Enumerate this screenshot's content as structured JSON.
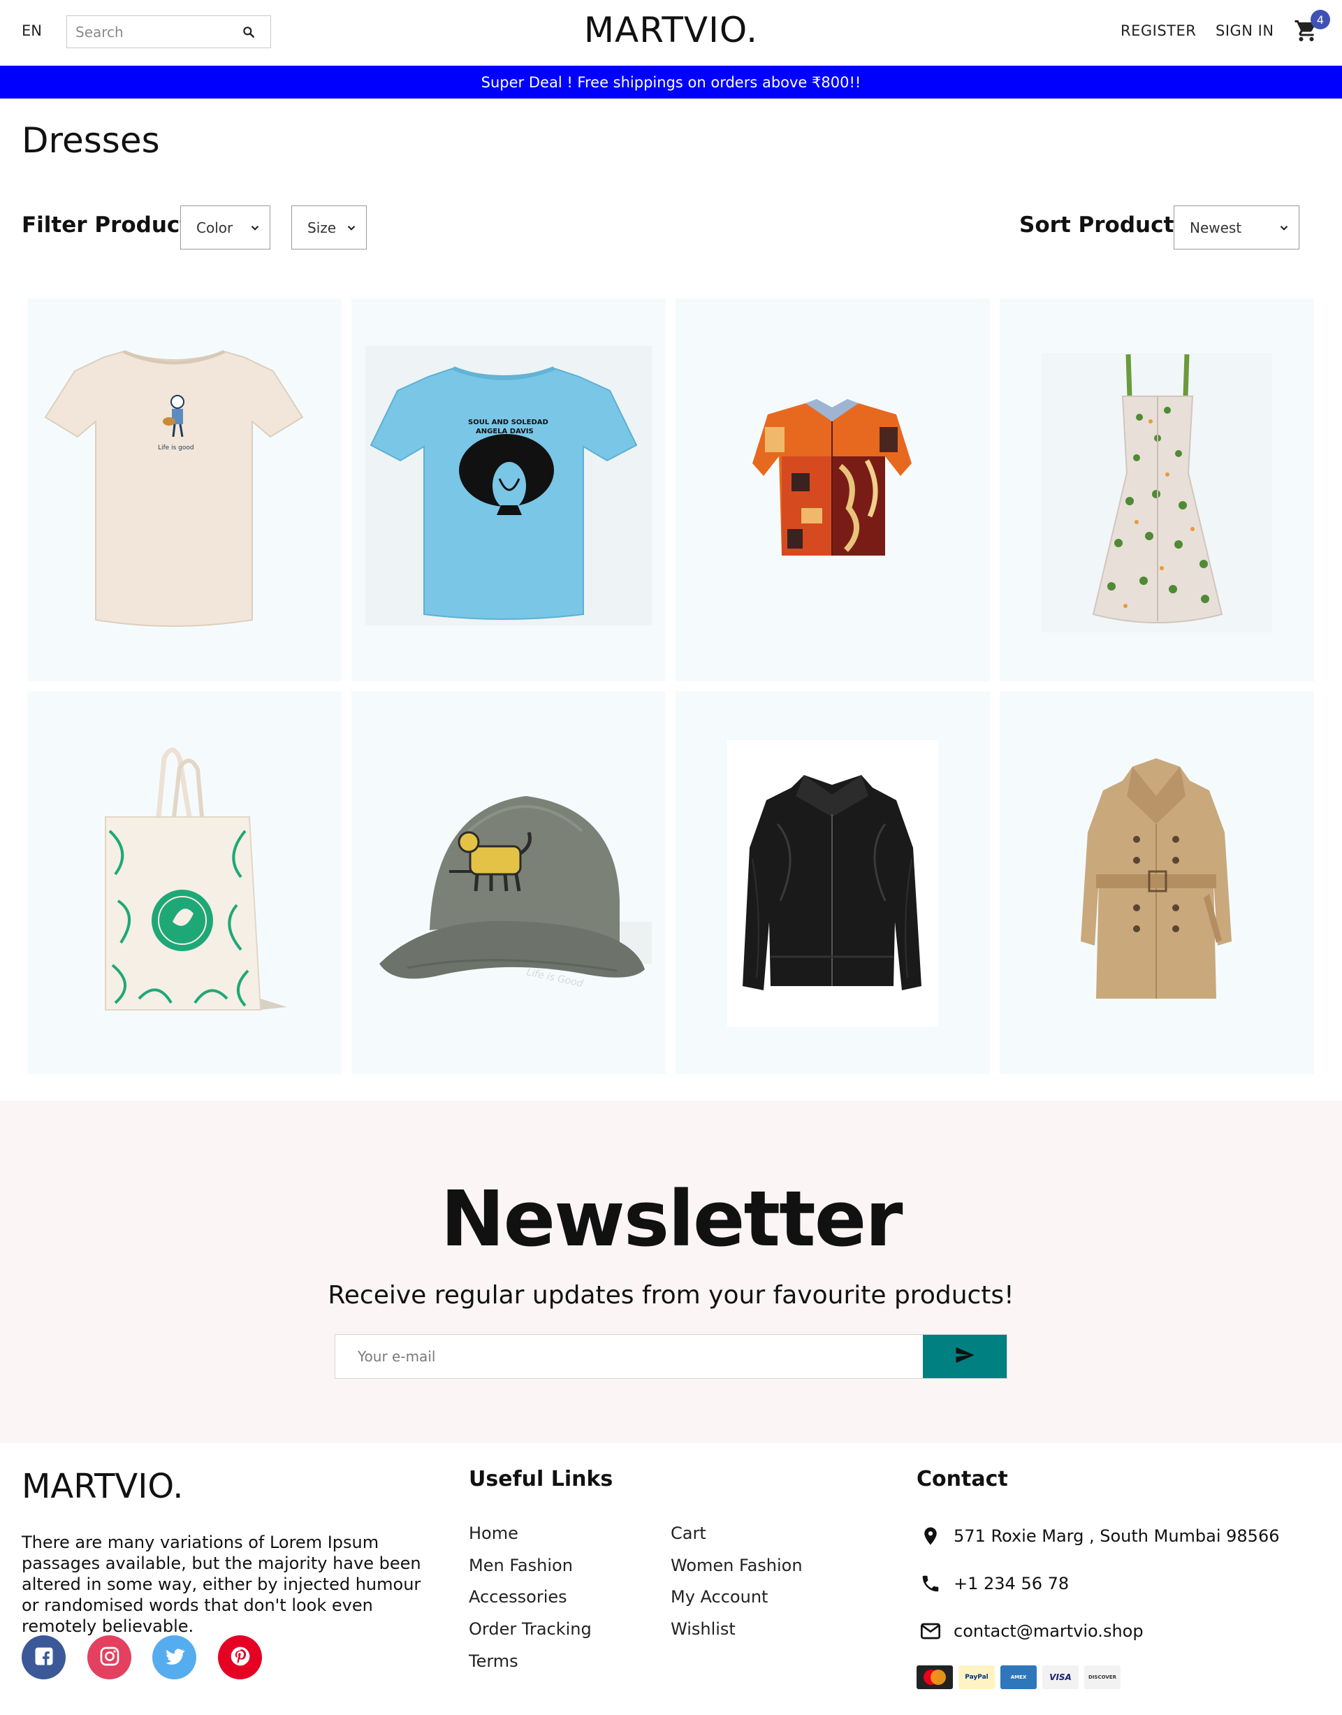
{
  "header": {
    "language": "EN",
    "search_placeholder": "Search",
    "logo": "MARTVIO.",
    "register": "REGISTER",
    "sign_in": "SIGN IN",
    "cart_count": "4"
  },
  "announcement": "Super Deal ! Free shippings on orders above ₹800!!",
  "page_title": "Dresses",
  "filters": {
    "label": "Filter Products:",
    "color": "Color",
    "size": "Size"
  },
  "sort": {
    "label": "Sort Products:",
    "selected": "Newest"
  },
  "products": [
    {
      "name": "cream-tshirt"
    },
    {
      "name": "blue-graphic-tshirt"
    },
    {
      "name": "patterned-shirt"
    },
    {
      "name": "floral-dress"
    },
    {
      "name": "tote-bag"
    },
    {
      "name": "grey-cap"
    },
    {
      "name": "leather-jacket"
    },
    {
      "name": "trench-coat"
    }
  ],
  "newsletter": {
    "title": "Newsletter",
    "description": "Receive regular updates from your favourite products!",
    "placeholder": "Your e-mail"
  },
  "footer": {
    "logo": "MARTVIO.",
    "description": "There are many variations of Lorem Ipsum passages available, but the majority have been altered in some way, either by injected humour or randomised words that don't look even remotely believable.",
    "useful_links_title": "Useful Links",
    "links_col1": [
      "Home",
      "Men Fashion",
      "Accessories",
      "Order Tracking",
      "Terms"
    ],
    "links_col2": [
      "Cart",
      "Women Fashion",
      "My Account",
      "Wishlist"
    ],
    "contact_title": "Contact",
    "address": "571 Roxie Marg , South Mumbai 98566",
    "phone": "+1 234 56 78",
    "email": "contact@martvio.shop",
    "payments": [
      "MasterCard",
      "PayPal",
      "AMERICAN EXPRESS",
      "VISA",
      "DISCOVER"
    ]
  },
  "colors": {
    "announcement_bg": "#0000ff",
    "newsletter_bg": "#fcf5f5",
    "send_button": "#008080",
    "cart_badge": "#3f51b5",
    "product_bg": "#f5fbfd"
  }
}
